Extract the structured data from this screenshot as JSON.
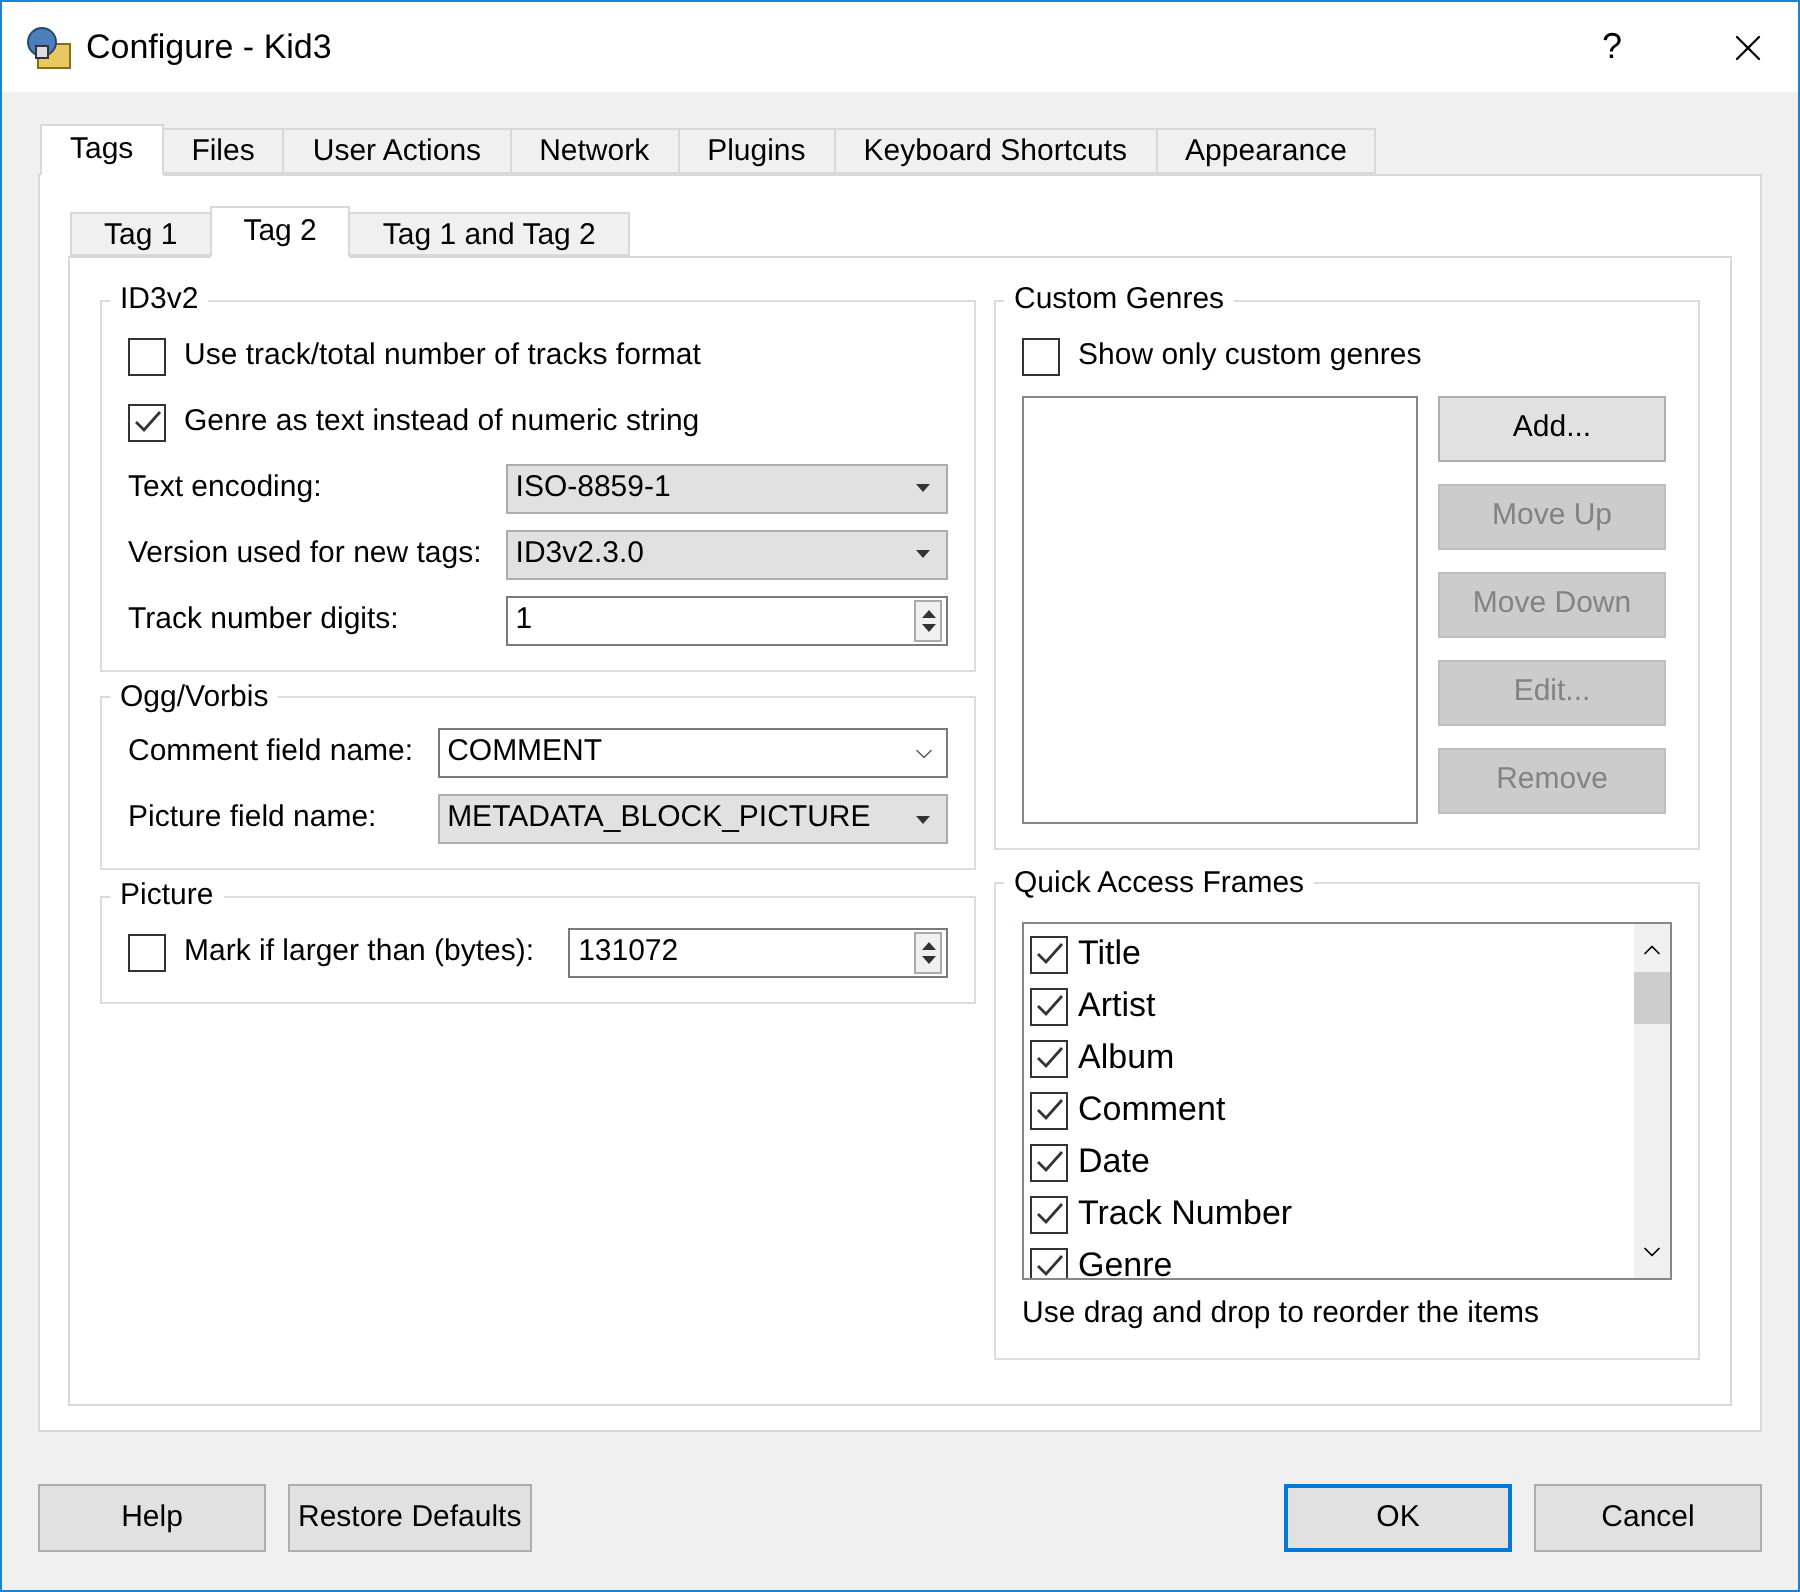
{
  "window": {
    "title": "Configure - Kid3",
    "help": "?"
  },
  "tabs": [
    {
      "label": "Tags",
      "selected": true
    },
    {
      "label": "Files",
      "selected": false
    },
    {
      "label": "User Actions",
      "selected": false
    },
    {
      "label": "Network",
      "selected": false
    },
    {
      "label": "Plugins",
      "selected": false
    },
    {
      "label": "Keyboard Shortcuts",
      "selected": false
    },
    {
      "label": "Appearance",
      "selected": false
    }
  ],
  "subtabs": [
    {
      "label": "Tag 1",
      "selected": false
    },
    {
      "label": "Tag 2",
      "selected": true
    },
    {
      "label": "Tag 1 and Tag 2",
      "selected": false
    }
  ],
  "left_groups": [
    {
      "title": "ID3v2",
      "rows": [
        {
          "kind": "checkbox",
          "label": "Use track/total number of tracks format",
          "checked": false
        },
        {
          "kind": "checkbox",
          "label": "Genre as text instead of numeric string",
          "checked": true
        },
        {
          "kind": "select",
          "label": "Text encoding:",
          "value": "ISO-8859-1"
        },
        {
          "kind": "select",
          "label": "Version used for new tags:",
          "value": "ID3v2.3.0"
        },
        {
          "kind": "spin",
          "label": "Track number digits:",
          "value": "1"
        }
      ]
    },
    {
      "title": "Ogg/Vorbis",
      "rows": [
        {
          "kind": "combo",
          "label": "Comment field name:",
          "value": "COMMENT"
        },
        {
          "kind": "select",
          "label": "Picture field name:",
          "value": "METADATA_BLOCK_PICTURE"
        }
      ]
    },
    {
      "title": "Picture",
      "rows": [
        {
          "kind": "checkspin",
          "label": "Mark if larger than (bytes):",
          "checked": false,
          "value": "131072"
        }
      ]
    }
  ],
  "custom_genres": {
    "title": "Custom Genres",
    "show_only": {
      "label": "Show only custom genres",
      "checked": false
    },
    "buttons": [
      {
        "label": "Add...",
        "disabled": false
      },
      {
        "label": "Move Up",
        "disabled": true
      },
      {
        "label": "Move Down",
        "disabled": true
      },
      {
        "label": "Edit...",
        "disabled": true
      },
      {
        "label": "Remove",
        "disabled": true
      }
    ]
  },
  "quick_access": {
    "title": "Quick Access Frames",
    "items": [
      {
        "label": "Title",
        "checked": true
      },
      {
        "label": "Artist",
        "checked": true
      },
      {
        "label": "Album",
        "checked": true
      },
      {
        "label": "Comment",
        "checked": true
      },
      {
        "label": "Date",
        "checked": true
      },
      {
        "label": "Track Number",
        "checked": true
      },
      {
        "label": "Genre",
        "checked": true
      }
    ],
    "hint": "Use drag and drop to reorder the items"
  },
  "footer_left": [
    {
      "label": "Help",
      "default": false
    },
    {
      "label": "Restore Defaults",
      "default": false
    }
  ],
  "footer_right": [
    {
      "label": "OK",
      "default": true
    },
    {
      "label": "Cancel",
      "default": false
    }
  ]
}
